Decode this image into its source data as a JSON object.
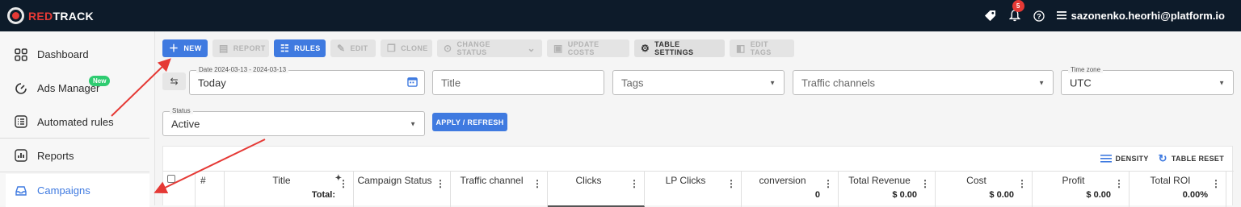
{
  "brand": {
    "red": "RED",
    "white": "TRACK"
  },
  "header": {
    "notification_count": "5",
    "user": "sazonenko.heorhi@platform.io"
  },
  "sidebar": {
    "items": [
      {
        "label": "Dashboard",
        "icon": "grid-icon"
      },
      {
        "label": "Ads Manager",
        "icon": "gauge-icon",
        "badge": "New"
      },
      {
        "label": "Automated rules",
        "icon": "list-icon"
      },
      {
        "label": "Reports",
        "icon": "chart-icon"
      },
      {
        "label": "Campaigns",
        "icon": "inbox-icon"
      }
    ]
  },
  "toolbar": {
    "new": "NEW",
    "report": "REPORT",
    "rules": "RULES",
    "edit": "EDIT",
    "clone": "CLONE",
    "change_status": "CHANGE STATUS",
    "update_costs": "UPDATE COSTS",
    "table_settings": "TABLE SETTINGS",
    "edit_tags": "EDIT TAGS"
  },
  "filters": {
    "date_legend": "Date 2024-03-13 - 2024-03-13",
    "date_value": "Today",
    "title_placeholder": "Title",
    "tags_placeholder": "Tags",
    "traffic_placeholder": "Traffic channels",
    "timezone_legend": "Time zone",
    "timezone_value": "UTC",
    "status_legend": "Status",
    "status_value": "Active",
    "apply": "APPLY / REFRESH"
  },
  "table": {
    "density": "DENSITY",
    "reset": "TABLE RESET",
    "columns": [
      {
        "label": "#"
      },
      {
        "label": "Title",
        "total": "Total:"
      },
      {
        "label": "Campaign Status"
      },
      {
        "label": "Traffic channel"
      },
      {
        "label": "Clicks"
      },
      {
        "label": "LP Clicks"
      },
      {
        "label": "conversion",
        "total": "0"
      },
      {
        "label": "Total Revenue",
        "total": "$ 0.00"
      },
      {
        "label": "Cost",
        "total": "$ 0.00"
      },
      {
        "label": "Profit",
        "total": "$ 0.00"
      },
      {
        "label": "Total ROI",
        "total": "0.00%"
      }
    ]
  },
  "colors": {
    "accent": "#3f7ae0",
    "topbar": "#0d1b2a",
    "brand_red": "#e53935",
    "badge_green": "#2ecc71"
  }
}
